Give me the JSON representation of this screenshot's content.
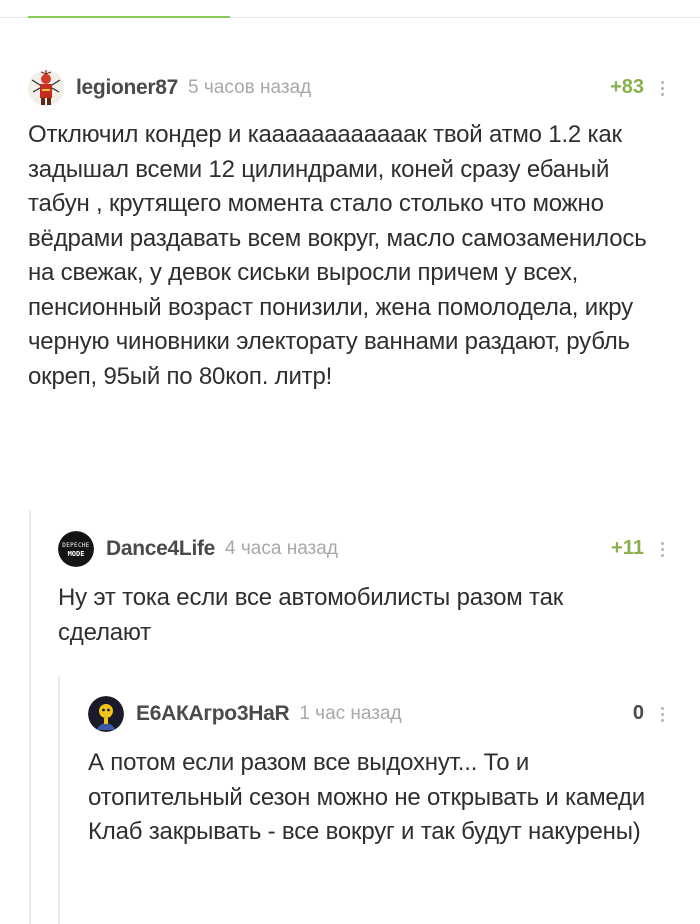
{
  "comments": [
    {
      "author": "legioner87",
      "time": "5 часов назад",
      "rating": "+83",
      "avatar": "red-figure-avatar",
      "text": "Отключил кондер и каааааааааааак твой атмо 1.2 как задышал всеми 12 цилиндрами, коней сразу ебаный табун , крутящего момента стало столько что можно вёдрами раздавать всем вокруг, масло самозаменилось на свежак, у девок сиськи выросли причем у всех, пенсионный возраст понизили, жена помолодела, икру черную чиновники электорату ваннами раздают, рубль окреп, 95ый по 80коп. литр!"
    },
    {
      "author": "Dance4Life",
      "time": "4 часа назад",
      "rating": "+11",
      "avatar": "depeche-mode-logo-avatar",
      "avatar_text_top": "DEPECHE",
      "avatar_text_bottom": "MODE",
      "text": "Ну эт тока если все автомобилисты разом так сделают"
    },
    {
      "author": "Е6АКАгро3НаR",
      "time": "1 час назад",
      "rating": "0",
      "avatar": "yellow-figure-avatar",
      "text": "А потом если разом все выдохнут... То и отопительный сезон можно не открывать и камеди Клаб закрывать - все вокруг и так будут накурены)"
    }
  ],
  "colors": {
    "accent": "#8ac858",
    "rating_positive": "#8ab04c",
    "text": "#2f2f2f",
    "meta": "#a8a8a8"
  }
}
